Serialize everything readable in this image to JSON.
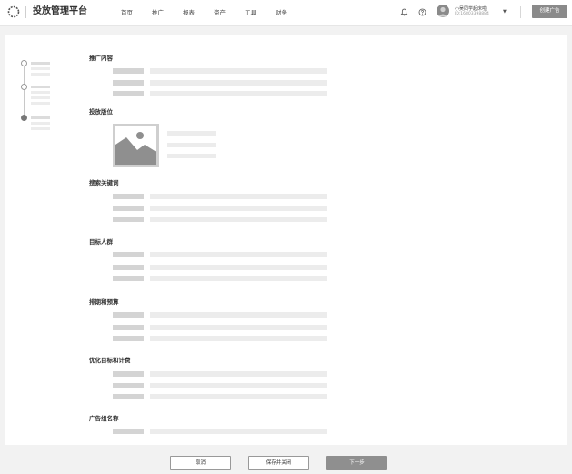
{
  "header": {
    "brand": "投放管理平台",
    "nav": [
      {
        "label": "首页"
      },
      {
        "label": "推广"
      },
      {
        "label": "报表"
      },
      {
        "label": "资产"
      },
      {
        "label": "工具"
      },
      {
        "label": "财务"
      }
    ],
    "user": {
      "name": "小吴同学起床啦",
      "id": "ID:16803398884"
    },
    "create_button": "创建广告",
    "icons": {
      "logo": "logo-icon",
      "notification": "bell-icon",
      "help": "help-icon",
      "menu": "chevron-down-icon"
    }
  },
  "sections": [
    {
      "title": "推广内容"
    },
    {
      "title": "投放版位"
    },
    {
      "title": "搜索关键词"
    },
    {
      "title": "目标人群"
    },
    {
      "title": "排期和预算"
    },
    {
      "title": "优化目标和计费"
    },
    {
      "title": "广告组名称"
    }
  ],
  "footer": {
    "cancel": "取消",
    "save_close": "保存并关闭",
    "next": "下一步"
  },
  "colors": {
    "accent": "#8a8a8a",
    "placeholder_dark": "#d4d4d4",
    "placeholder_light": "#ececec"
  }
}
